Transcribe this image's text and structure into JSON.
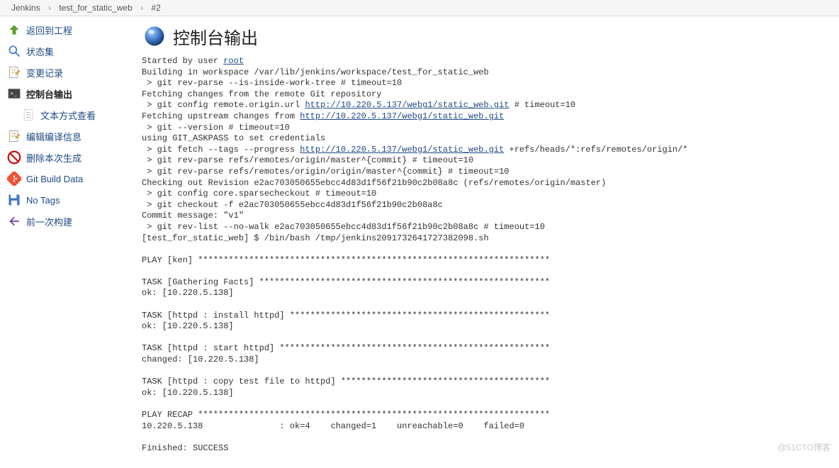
{
  "breadcrumb": {
    "items": [
      "Jenkins",
      "test_for_static_web",
      "#2"
    ]
  },
  "sidebar": {
    "items": [
      {
        "label": "返回到工程",
        "icon": "up-arrow",
        "color": "#5b9e2d"
      },
      {
        "label": "状态集",
        "icon": "search",
        "color": "#3d77c8"
      },
      {
        "label": "变更记录",
        "icon": "notepad",
        "color": "#d8a038"
      },
      {
        "label": "控制台输出",
        "icon": "terminal",
        "color": "#444",
        "selected": true
      },
      {
        "label": "文本方式查看",
        "icon": "document",
        "color": "#ccc",
        "sub": true
      },
      {
        "label": "编辑编译信息",
        "icon": "notepad",
        "color": "#d8a038"
      },
      {
        "label": "删除本次生成",
        "icon": "no-entry",
        "color": "#cc0000"
      },
      {
        "label": "Git Build Data",
        "icon": "git",
        "color": "#f05133"
      },
      {
        "label": "No Tags",
        "icon": "save",
        "color": "#3d77c8"
      },
      {
        "label": "前一次构建",
        "icon": "arrow-left",
        "color": "#6a3fa0"
      }
    ]
  },
  "page": {
    "title": "控制台输出"
  },
  "console": {
    "start_prefix": "Started by user ",
    "user_link_text": "root",
    "line_building": "Building in workspace /var/lib/jenkins/workspace/test_for_static_web",
    "line_rev_parse_inside": " > git rev-parse --is-inside-work-tree # timeout=10",
    "line_fetching": "Fetching changes from the remote Git repository",
    "line_config_remote_prefix": " > git config remote.origin.url ",
    "url_repo": "http://10.220.5.137/webg1/static_web.git",
    "line_config_remote_suffix": " # timeout=10",
    "line_fetch_upstream_prefix": "Fetching upstream changes from ",
    "line_git_version": " > git --version # timeout=10",
    "line_git_askpass": "using GIT_ASKPASS to set credentials ",
    "line_git_fetch_prefix": " > git fetch --tags --progress ",
    "line_git_fetch_suffix": " +refs/heads/*:refs/remotes/origin/*",
    "line_rev_parse_master": " > git rev-parse refs/remotes/origin/master^{commit} # timeout=10",
    "line_rev_parse_origin_master": " > git rev-parse refs/remotes/origin/origin/master^{commit} # timeout=10",
    "line_checkout_revision": "Checking out Revision e2ac703050655ebcc4d83d1f56f21b90c2b08a8c (refs/remotes/origin/master)",
    "line_sparsecheckout": " > git config core.sparsecheckout # timeout=10",
    "line_checkout_f": " > git checkout -f e2ac703050655ebcc4d83d1f56f21b90c2b08a8c",
    "line_commit_msg": "Commit message: \"v1\"",
    "line_rev_list": " > git rev-list --no-walk e2ac703050655ebcc4d83d1f56f21b90c2b08a8c # timeout=10",
    "line_shell": "[test_for_static_web] $ /bin/bash /tmp/jenkins2091732641727382098.sh",
    "line_play_ken": "PLAY [ken] *********************************************************************",
    "line_task_gather": "TASK [Gathering Facts] *********************************************************",
    "line_ok_138_1": "ok: [10.220.5.138]",
    "line_task_install": "TASK [httpd : install httpd] ***************************************************",
    "line_ok_138_2": "ok: [10.220.5.138]",
    "line_task_start": "TASK [httpd : start httpd] *****************************************************",
    "line_changed_138": "changed: [10.220.5.138]",
    "line_task_copy": "TASK [httpd : copy test file to httpd] *****************************************",
    "line_ok_138_3": "ok: [10.220.5.138]",
    "line_recap": "PLAY RECAP *********************************************************************",
    "line_recap_stats": "10.220.5.138               : ok=4    changed=1    unreachable=0    failed=0   ",
    "line_finished": "Finished: SUCCESS"
  },
  "watermark": "@51CTO博客"
}
